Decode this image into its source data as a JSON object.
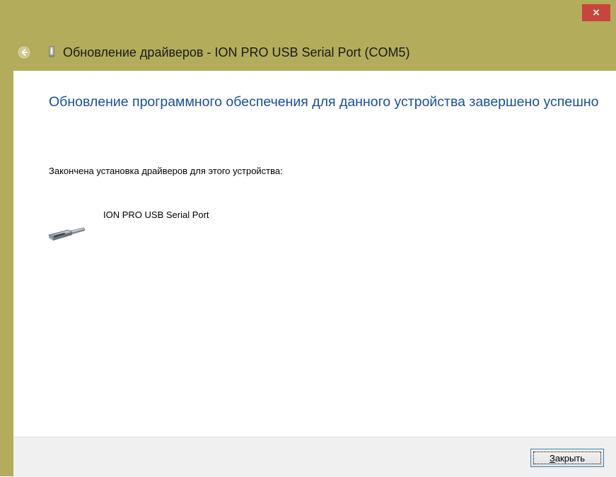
{
  "window": {
    "title_bar_color": "#b3ac5a",
    "close_icon": "×",
    "close_icon_name": "close-icon"
  },
  "header": {
    "back_icon": "back-arrow-icon",
    "device_icon": "usb-device-icon",
    "title": "Обновление драйверов - ION PRO USB Serial Port (COM5)"
  },
  "content": {
    "heading": "Обновление программного обеспечения для данного устройства завершено успешно",
    "info": "Закончена установка драйверов для этого устройства:",
    "device": {
      "icon": "serial-port-device-icon",
      "name": "ION PRO USB Serial Port"
    }
  },
  "footer": {
    "close_button_label": "Закрыть",
    "close_button_accesskey": "З"
  },
  "colors": {
    "accent_heading": "#1a4e9b",
    "close_red": "#c7453a",
    "footer_bg": "#f0f0f0"
  }
}
